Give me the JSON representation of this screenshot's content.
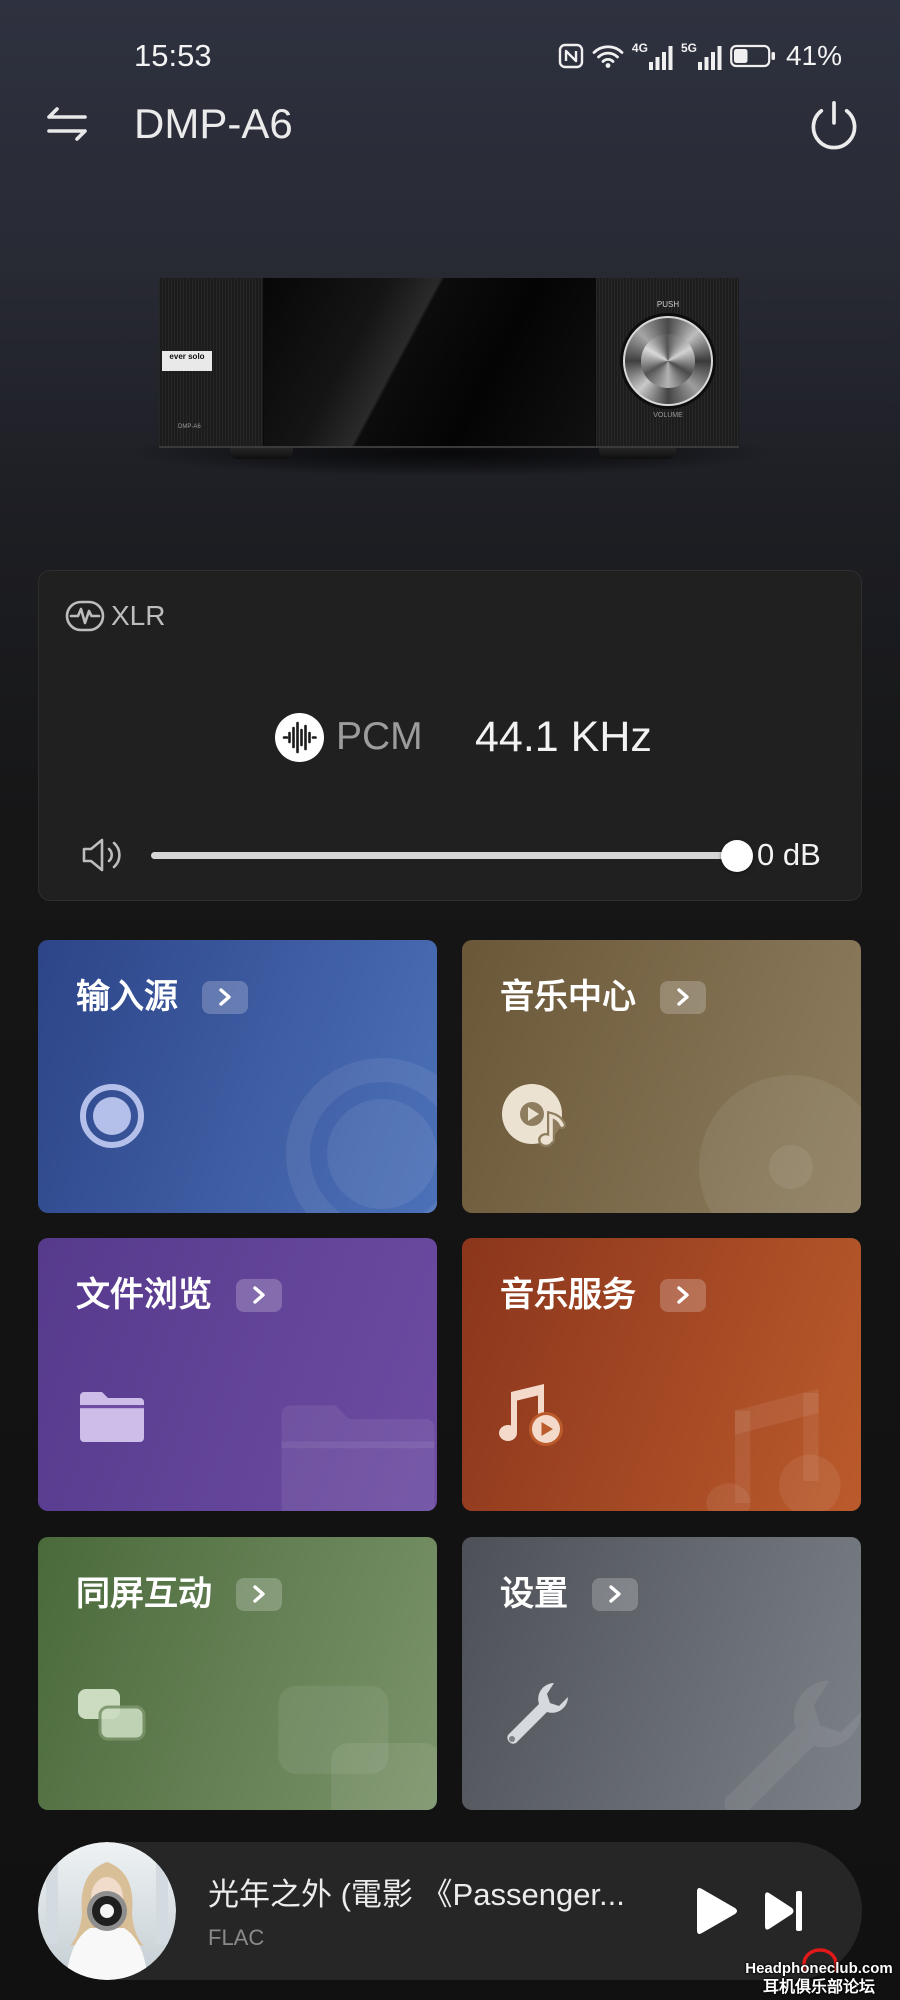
{
  "status_bar": {
    "time": "15:53",
    "nfc_icon": "nfc-icon",
    "wifi_icon": "wifi-icon",
    "network_1": "4G",
    "network_2": "5G",
    "battery_percent": "41%",
    "battery_level": 0.41
  },
  "header": {
    "title": "DMP-A6",
    "left_icon": "switch-device-icon",
    "right_icon": "power-icon"
  },
  "device_image": {
    "brand_logo": "ever solo",
    "model_label": "DMP-A6",
    "push_label": "PUSH",
    "volume_label": "VOLUME"
  },
  "output_card": {
    "port_icon": "xlr-output-icon",
    "port": "XLR",
    "format_icon": "waveform-icon",
    "format": "PCM",
    "sample_rate": "44.1 KHz",
    "volume_icon": "speaker-icon",
    "volume_text": "0 dB",
    "volume_level": 1.0
  },
  "tiles": [
    {
      "label": "输入源",
      "icon": "input-source-icon",
      "colors": [
        "#2d4488",
        "#4c71b8"
      ],
      "icon_color": "#b4c0ea"
    },
    {
      "label": "音乐中心",
      "icon": "music-center-disc-icon",
      "colors": [
        "#6a5738",
        "#8e7e5f"
      ],
      "icon_color": "#ece2d2"
    },
    {
      "label": "文件浏览",
      "icon": "folder-icon",
      "colors": [
        "#563a8c",
        "#6d4ca2"
      ],
      "icon_color": "#cdbde9"
    },
    {
      "label": "音乐服务",
      "icon": "music-service-icon",
      "colors": [
        "#8b351c",
        "#bb5b2c"
      ],
      "icon_color": "#f4dacb"
    },
    {
      "label": "同屏互动",
      "icon": "screen-mirror-icon",
      "colors": [
        "#4a6a3b",
        "#7c946b"
      ],
      "icon_color": "#cbdcc0"
    },
    {
      "label": "设置",
      "icon": "wrench-icon",
      "colors": [
        "#4d5157",
        "#7c8188"
      ],
      "icon_color": "#d6d9dd"
    }
  ],
  "now_playing": {
    "title": "光年之外 (電影 《Passenger...",
    "format": "FLAC",
    "album_art": "album-cover",
    "play_icon": "play-icon",
    "next_icon": "next-track-icon"
  },
  "watermark": {
    "site": "Headphoneclub.com",
    "name": "耳机俱乐部论坛"
  }
}
